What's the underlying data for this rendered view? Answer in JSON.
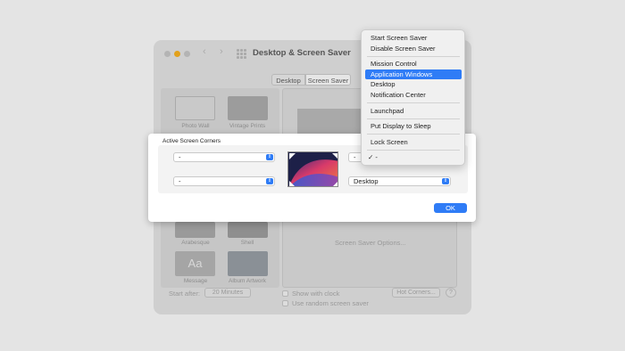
{
  "window": {
    "title": "Desktop & Screen Saver",
    "tabs": [
      "Desktop",
      "Screen Saver"
    ],
    "thumbnails": [
      {
        "label": "Photo Wall"
      },
      {
        "label": "Vintage Prints"
      },
      {
        "label": "Arabesque"
      },
      {
        "label": "Shell"
      },
      {
        "label": "Message",
        "glyph": "Aa"
      },
      {
        "label": "Album Artwork"
      }
    ],
    "screen_saver_options": "Screen Saver Options...",
    "start_after_label": "Start after:",
    "start_after_value": "20 Minutes",
    "show_with_clock": "Show with clock",
    "use_random": "Use random screen saver",
    "hot_corners": "Hot Corners...",
    "help": "?"
  },
  "sheet": {
    "title": "Active Screen Corners",
    "corners": {
      "top_left": "-",
      "top_right": "-",
      "bottom_left": "-",
      "bottom_right": "Desktop"
    },
    "ok": "OK"
  },
  "menu": {
    "items": [
      "Start Screen Saver",
      "Disable Screen Saver",
      "Mission Control",
      "Application Windows",
      "Desktop",
      "Notification Center",
      "Launchpad",
      "Put Display to Sleep",
      "Lock Screen",
      "-"
    ],
    "selected": "Application Windows",
    "checked": "-",
    "checkmark": "✓"
  },
  "colors": {
    "accent": "#2f7cf6",
    "background": "#e4e4e4",
    "dimmed_window": "#cfcfcf"
  },
  "icons": [
    "close-dot",
    "minimize-dot",
    "zoom-dot",
    "chevron-left-icon",
    "chevron-right-icon",
    "grid-icon",
    "stepper-icon",
    "checkmark-icon"
  ]
}
